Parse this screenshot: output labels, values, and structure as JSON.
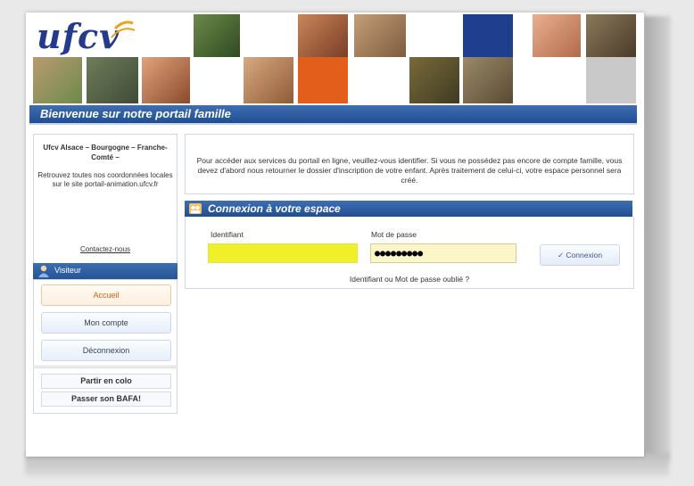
{
  "header": {
    "logo_text": "ufcv",
    "banner_title": "Bienvenue sur notre portail famille"
  },
  "sidebar": {
    "org_name": "Ufcv Alsace – Bourgogne – Franche-Comté –",
    "description": "Retrouvez toutes nos coordonnées locales sur le site portail-animation.ufcv.fr",
    "contact_link": "Contactez-nous",
    "visitor_label": "Visiteur",
    "nav": [
      {
        "label": "Accueil",
        "active": true
      },
      {
        "label": "Mon compte",
        "active": false
      },
      {
        "label": "Déconnexion",
        "active": false
      }
    ],
    "links": [
      {
        "label": "Partir en colo"
      },
      {
        "label": "Passer son BAFA!"
      }
    ]
  },
  "intro": {
    "text": "Pour accéder aux services du portail en ligne, veuillez-vous identifier. Si vous ne possédez pas encore de compte famille, vous devez d'abord nous retourner le dossier d'inscription de votre enfant. Après traitement de celui-ci, votre espace personnel sera créé."
  },
  "login": {
    "title": "Connexion à votre espace",
    "username_label": "Identifiant",
    "username_value": "",
    "password_label": "Mot de passe",
    "password_value": "●●●●●●●●●",
    "submit_label": "✓ Connexion",
    "forgot_link": "Identifiant ou Mot de passe oublié ?"
  },
  "colors": {
    "banner_blue": "#1f4e92",
    "logo_blue": "#243a8c",
    "active_orange": "#d2641a",
    "username_fill": "#f0f02a",
    "password_fill": "#fbf5c8"
  }
}
